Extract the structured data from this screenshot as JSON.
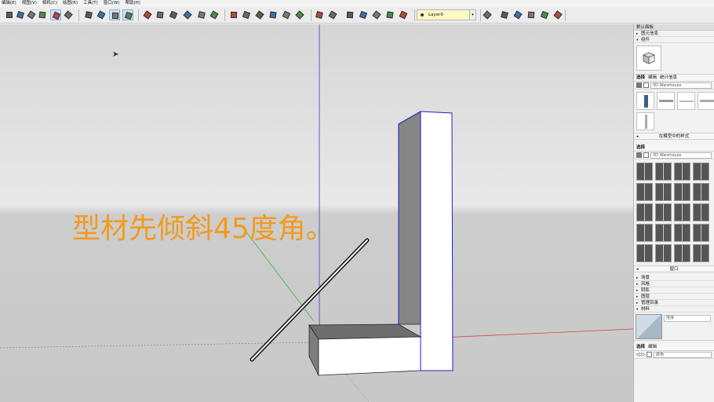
{
  "menu": [
    "编辑(E)",
    "视图(V)",
    "相机(C)",
    "绘图(R)",
    "工具(T)",
    "窗口(W)",
    "帮助(H)"
  ],
  "toolbar": {
    "layer_value": "Layer0"
  },
  "viewport": {
    "caption": "型材先倾斜45度角。"
  },
  "tray": {
    "title": "默认面板",
    "sections_top": [
      {
        "tri": "▸",
        "label": "图元信息"
      },
      {
        "tri": "▾",
        "label": "组件"
      }
    ],
    "components": {
      "tabs": [
        "选择",
        "编辑",
        "统计信息"
      ],
      "search_placeholder": "3D Warehouse",
      "footer_label": "在模型中的样式"
    },
    "select_panel": {
      "tab": "选择",
      "search_placeholder": "3D Warehouse",
      "footer_label": "窗口"
    },
    "sections_bottom": [
      {
        "tri": "▸",
        "label": "场景"
      },
      {
        "tri": "▸",
        "label": "风格"
      },
      {
        "tri": "▸",
        "label": "阴影"
      },
      {
        "tri": "▸",
        "label": "图层"
      },
      {
        "tri": "▸",
        "label": "管理目录"
      },
      {
        "tri": "▾",
        "label": "材料"
      }
    ],
    "materials": {
      "swatch_label": "搭接",
      "tabs": [
        "选择",
        "编辑"
      ],
      "search_value": "颜色"
    }
  },
  "icons": {
    "layer_dot": "layer-icon",
    "component_preview": "component-cube-icon",
    "material_swatch": "material-swatch-icon"
  }
}
